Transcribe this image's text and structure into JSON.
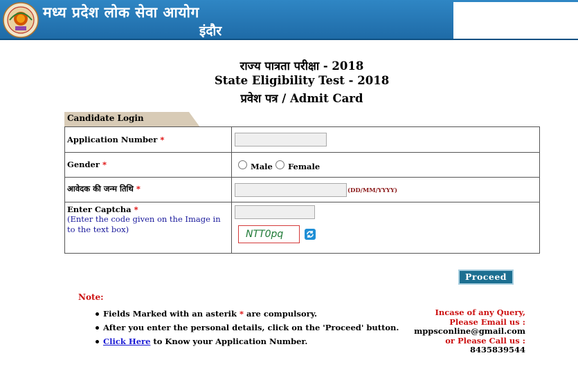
{
  "header": {
    "org_name": "मध्य प्रदेश लोक सेवा आयोग",
    "city": "इंदौर",
    "bg_color": "#1e6aa6"
  },
  "title": {
    "line1": "राज्य पात्रता परीक्षा - 2018",
    "line2": "State Eligibility Test - 2018",
    "line3": "प्रवेश पत्र / Admit Card"
  },
  "form": {
    "tab_label": "Candidate Login",
    "application_number_label": "Application Number",
    "application_number_value": "",
    "gender_label": "Gender",
    "gender_options": [
      "Male",
      "Female"
    ],
    "dob_label": "आवेदक की जन्म तिथि",
    "dob_value": "",
    "dob_hint": "(DD/MM/YYYY)",
    "captcha_label": "Enter Captcha",
    "captcha_help": "(Enter the code given on the Image in to the text box)",
    "captcha_input_value": "",
    "captcha_code": "NTT0pq",
    "required_mark": "*",
    "proceed_label": "Proceed"
  },
  "notes": {
    "title": "Note:",
    "item1_before": "Fields Marked with an asterik ",
    "item1_star": "*",
    "item1_after": " are compulsory.",
    "item2": "After you enter the personal details, click on the 'Proceed' button.",
    "item3_link": "Click Here",
    "item3_after": " to Know your Application Number."
  },
  "contact": {
    "line1": "Incase of any Query,",
    "line2": "Please Email us :",
    "email": "mppsconline@gmail.com",
    "line3": "or Please Call us :",
    "phone": "8435839544"
  }
}
